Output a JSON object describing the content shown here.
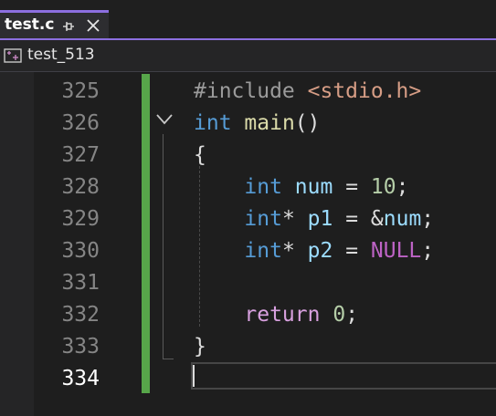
{
  "tab": {
    "title": "test.c",
    "pin_icon": "pin-icon",
    "close_icon": "close-icon"
  },
  "nav": {
    "project": "test_513",
    "icon": "project-scope-icon"
  },
  "colors": {
    "accent": "#8c6fe0",
    "change_bar": "#57a64a",
    "keyword": "#569cd6",
    "function": "#dcdcaa",
    "variable": "#9cdcfe",
    "number": "#b5cea8",
    "control": "#d8a0df",
    "include_string": "#d69d85"
  },
  "line_numbers": [
    "325",
    "326",
    "327",
    "328",
    "329",
    "330",
    "331",
    "332",
    "333",
    "334"
  ],
  "code": {
    "l325": {
      "directive": "#include ",
      "header": "<stdio.h>"
    },
    "l326": {
      "type": "int",
      "name": "main",
      "paren": "()"
    },
    "l327": {
      "brace": "{"
    },
    "l328": {
      "type": "int",
      "name": "num",
      "op": " = ",
      "value": "10",
      "end": ";"
    },
    "l329": {
      "type": "int",
      "star": "*",
      "name": " p1",
      "op": " = ",
      "amp": "&",
      "value": "num",
      "end": ";"
    },
    "l330": {
      "type": "int",
      "star": "*",
      "name": " p2",
      "op": " = ",
      "value": "NULL",
      "end": ";"
    },
    "l332": {
      "keyword": "return",
      "value": "0",
      "end": ";"
    },
    "l333": {
      "brace": "}"
    }
  }
}
